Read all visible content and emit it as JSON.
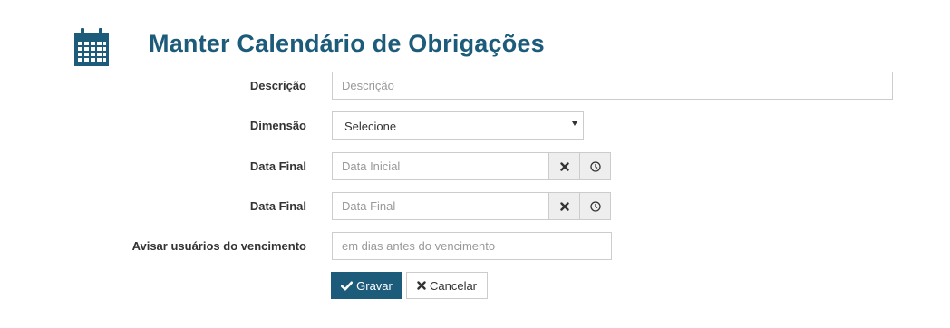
{
  "page": {
    "icon": "calendar-icon",
    "title": "Manter Calendário de Obrigações"
  },
  "form": {
    "descricao": {
      "label": "Descrição",
      "placeholder": "Descrição"
    },
    "dimensao": {
      "label": "Dimensão",
      "selected": "Selecione"
    },
    "data_inicial": {
      "label": "Data Final",
      "placeholder": "Data Inicial"
    },
    "data_final": {
      "label": "Data Final",
      "placeholder": "Data Final"
    },
    "avisar": {
      "label": "Avisar usuários do vencimento",
      "placeholder": "em dias antes do vencimento"
    }
  },
  "icons": {
    "clear": "close-icon",
    "time": "clock-icon",
    "select_caret": "chevron-down-icon",
    "save": "check-icon",
    "cancel": "close-icon"
  },
  "actions": {
    "save_label": "Gravar",
    "cancel_label": "Cancelar"
  },
  "colors": {
    "brand": "#1d5b7b",
    "addon_bg": "#eeeeee",
    "border": "#cccccc"
  }
}
